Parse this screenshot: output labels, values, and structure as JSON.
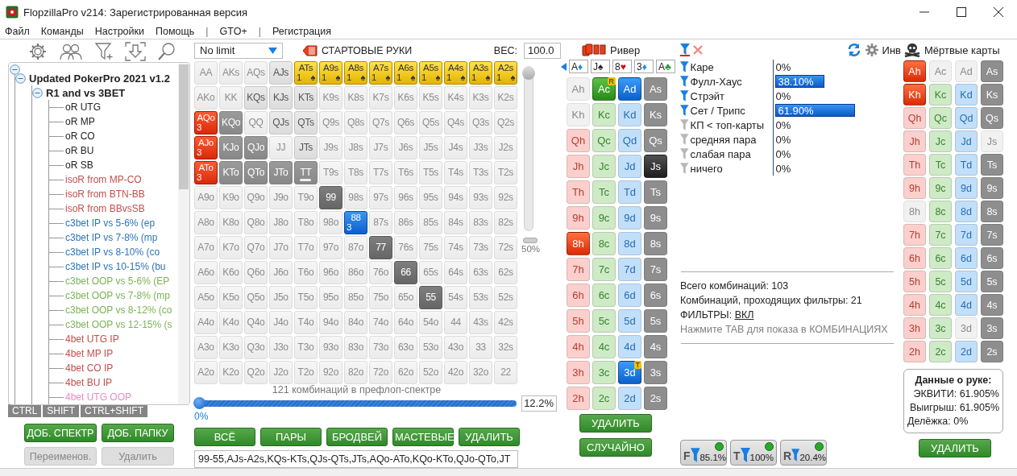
{
  "window": {
    "title": "FlopzillaPro v214: Зарегистрированная версия"
  },
  "menu": [
    {
      "label": "Файл",
      "kind": "item"
    },
    {
      "label": "Команды",
      "kind": "item"
    },
    {
      "label": "Настройки",
      "kind": "item"
    },
    {
      "label": "Помощь",
      "kind": "item"
    },
    {
      "label": "|",
      "kind": "separator"
    },
    {
      "label": "GTO+",
      "kind": "item"
    },
    {
      "label": "|",
      "kind": "separator"
    },
    {
      "label": "Регистрация",
      "kind": "item"
    }
  ],
  "left_panel": {
    "tree": {
      "expanded": true,
      "children": [
        {
          "label": "Updated PokerPro 2021 v1.2",
          "expanded": true,
          "children": [
            {
              "label": "R1 and vs 3BET",
              "expanded": true,
              "children": [
                {
                  "label": "oR UTG",
                  "color": "#222222"
                },
                {
                  "label": "oR MP",
                  "color": "#222222"
                },
                {
                  "label": "oR CO",
                  "color": "#222222"
                },
                {
                  "label": "oR BU",
                  "color": "#222222"
                },
                {
                  "label": "oR SB",
                  "color": "#222222"
                },
                {
                  "label": "isoR from MP-CO",
                  "color": "#c0504d"
                },
                {
                  "label": "isoR from BTN-BB",
                  "color": "#c0504d"
                },
                {
                  "label": "isoR from BBvsSB",
                  "color": "#c0504d"
                },
                {
                  "label": "c3bet IP vs 5-6% (ep",
                  "color": "#2e75b6"
                },
                {
                  "label": "c3bet IP vs 7-8% (mp",
                  "color": "#2e75b6"
                },
                {
                  "label": "c3bet IP vs 8-10% (co",
                  "color": "#2e75b6"
                },
                {
                  "label": "c3bet IP vs 10-15% (bu",
                  "color": "#2e75b6"
                },
                {
                  "label": "c3bet OOP vs 5-6% (EP",
                  "color": "#7ab356"
                },
                {
                  "label": "c3bet OOP vs 7-8% (mp",
                  "color": "#7ab356"
                },
                {
                  "label": "c3bet OOP vs 8-12% (co",
                  "color": "#7ab356"
                },
                {
                  "label": "c3bet OOP vs 12-15% (s",
                  "color": "#7ab356"
                },
                {
                  "label": "4bet UTG IP",
                  "color": "#c0504d"
                },
                {
                  "label": "4bet MP IP",
                  "color": "#c0504d"
                },
                {
                  "label": "4bet CO IP",
                  "color": "#c0504d"
                },
                {
                  "label": "4bet BU IP",
                  "color": "#c0504d"
                },
                {
                  "label": "4bet UTG OOP",
                  "color": "#e88cc0"
                }
              ]
            }
          ]
        }
      ]
    },
    "modifier_tabs": [
      "CTRL",
      "SHIFT",
      "CTRL+SHIFT"
    ],
    "buttons": [
      {
        "label": "ДОБ. СПЕКТР",
        "disabled": false
      },
      {
        "label": "ДОБ. ПАПКУ",
        "disabled": false
      },
      {
        "label": "Переименов.",
        "disabled": true
      },
      {
        "label": "Удалить",
        "disabled": true
      }
    ]
  },
  "range_editor": {
    "game": "No limit",
    "title": "СТАРТОВЫЕ РУКИ",
    "weight_label": "ВЕС:",
    "weight_value": "100.0",
    "grid": [
      [
        {
          "label": "AA",
          "kind": "off"
        },
        {
          "label": "AKs",
          "kind": "off"
        },
        {
          "label": "AQs",
          "kind": "off"
        },
        {
          "label": "AJs",
          "kind": "light"
        },
        {
          "label": "ATs",
          "kind": "yellow",
          "count": "1",
          "suit": "♠"
        },
        {
          "label": "A9s",
          "kind": "yellow",
          "count": "1",
          "suit": "♠"
        },
        {
          "label": "A8s",
          "kind": "yellow",
          "count": "1",
          "suit": "♠"
        },
        {
          "label": "A7s",
          "kind": "yellow",
          "count": "1",
          "suit": "♠"
        },
        {
          "label": "A6s",
          "kind": "yellow",
          "count": "1",
          "suit": "♠"
        },
        {
          "label": "A5s",
          "kind": "yellow",
          "count": "1",
          "suit": "♠"
        },
        {
          "label": "A4s",
          "kind": "yellow",
          "count": "1",
          "suit": "♠"
        },
        {
          "label": "A3s",
          "kind": "yellow",
          "count": "1",
          "suit": "♠"
        },
        {
          "label": "A2s",
          "kind": "yellow",
          "count": "1",
          "suit": "♠"
        }
      ],
      [
        {
          "label": "AKo",
          "kind": "off"
        },
        {
          "label": "KK",
          "kind": "off"
        },
        {
          "label": "KQs",
          "kind": "light"
        },
        {
          "label": "KJs",
          "kind": "light"
        },
        {
          "label": "KTs",
          "kind": "light"
        },
        {
          "label": "K9s",
          "kind": "off"
        },
        {
          "label": "K8s",
          "kind": "off"
        },
        {
          "label": "K7s",
          "kind": "off"
        },
        {
          "label": "K6s",
          "kind": "off"
        },
        {
          "label": "K5s",
          "kind": "off"
        },
        {
          "label": "K4s",
          "kind": "off"
        },
        {
          "label": "K3s",
          "kind": "off"
        },
        {
          "label": "K2s",
          "kind": "off"
        }
      ],
      [
        {
          "label": "AQo",
          "kind": "red",
          "count": "3"
        },
        {
          "label": "KQo",
          "kind": "mid"
        },
        {
          "label": "QQ",
          "kind": "off"
        },
        {
          "label": "QJs",
          "kind": "light"
        },
        {
          "label": "QTs",
          "kind": "light"
        },
        {
          "label": "Q9s",
          "kind": "off"
        },
        {
          "label": "Q8s",
          "kind": "off"
        },
        {
          "label": "Q7s",
          "kind": "off"
        },
        {
          "label": "Q6s",
          "kind": "off"
        },
        {
          "label": "Q5s",
          "kind": "off"
        },
        {
          "label": "Q4s",
          "kind": "off"
        },
        {
          "label": "Q3s",
          "kind": "off"
        },
        {
          "label": "Q2s",
          "kind": "off"
        }
      ],
      [
        {
          "label": "AJo",
          "kind": "red",
          "count": "3"
        },
        {
          "label": "KJo",
          "kind": "mid"
        },
        {
          "label": "QJo",
          "kind": "mid"
        },
        {
          "label": "JJ",
          "kind": "off"
        },
        {
          "label": "JTs",
          "kind": "light"
        },
        {
          "label": "J9s",
          "kind": "off"
        },
        {
          "label": "J8s",
          "kind": "off"
        },
        {
          "label": "J7s",
          "kind": "off"
        },
        {
          "label": "J6s",
          "kind": "off"
        },
        {
          "label": "J5s",
          "kind": "off"
        },
        {
          "label": "J4s",
          "kind": "off"
        },
        {
          "label": "J3s",
          "kind": "off"
        },
        {
          "label": "J2s",
          "kind": "off"
        }
      ],
      [
        {
          "label": "ATo",
          "kind": "red",
          "count": "3"
        },
        {
          "label": "KTo",
          "kind": "mid"
        },
        {
          "label": "QTo",
          "kind": "mid"
        },
        {
          "label": "JTo",
          "kind": "mid"
        },
        {
          "label": "TT",
          "kind": "mid",
          "partial": true
        },
        {
          "label": "T9s",
          "kind": "off"
        },
        {
          "label": "T8s",
          "kind": "off"
        },
        {
          "label": "T7s",
          "kind": "off"
        },
        {
          "label": "T6s",
          "kind": "off"
        },
        {
          "label": "T5s",
          "kind": "off"
        },
        {
          "label": "T4s",
          "kind": "off"
        },
        {
          "label": "T3s",
          "kind": "off"
        },
        {
          "label": "T2s",
          "kind": "off"
        }
      ],
      [
        {
          "label": "A9o",
          "kind": "off"
        },
        {
          "label": "K9o",
          "kind": "off"
        },
        {
          "label": "Q9o",
          "kind": "off"
        },
        {
          "label": "J9o",
          "kind": "off"
        },
        {
          "label": "T9o",
          "kind": "off"
        },
        {
          "label": "99",
          "kind": "dark"
        },
        {
          "label": "98s",
          "kind": "off"
        },
        {
          "label": "97s",
          "kind": "off"
        },
        {
          "label": "96s",
          "kind": "off"
        },
        {
          "label": "95s",
          "kind": "off"
        },
        {
          "label": "94s",
          "kind": "off"
        },
        {
          "label": "93s",
          "kind": "off"
        },
        {
          "label": "92s",
          "kind": "off"
        }
      ],
      [
        {
          "label": "A8o",
          "kind": "off"
        },
        {
          "label": "K8o",
          "kind": "off"
        },
        {
          "label": "Q8o",
          "kind": "off"
        },
        {
          "label": "J8o",
          "kind": "off"
        },
        {
          "label": "T8o",
          "kind": "off"
        },
        {
          "label": "98o",
          "kind": "off"
        },
        {
          "label": "88",
          "kind": "blue",
          "count": "3"
        },
        {
          "label": "87s",
          "kind": "off"
        },
        {
          "label": "86s",
          "kind": "off"
        },
        {
          "label": "85s",
          "kind": "off"
        },
        {
          "label": "84s",
          "kind": "off"
        },
        {
          "label": "83s",
          "kind": "off"
        },
        {
          "label": "82s",
          "kind": "off"
        }
      ],
      [
        {
          "label": "A7o",
          "kind": "off"
        },
        {
          "label": "K7o",
          "kind": "off"
        },
        {
          "label": "Q7o",
          "kind": "off"
        },
        {
          "label": "J7o",
          "kind": "off"
        },
        {
          "label": "T7o",
          "kind": "off"
        },
        {
          "label": "97o",
          "kind": "off"
        },
        {
          "label": "87o",
          "kind": "off"
        },
        {
          "label": "77",
          "kind": "dark"
        },
        {
          "label": "76s",
          "kind": "off"
        },
        {
          "label": "75s",
          "kind": "off"
        },
        {
          "label": "74s",
          "kind": "off"
        },
        {
          "label": "73s",
          "kind": "off"
        },
        {
          "label": "72s",
          "kind": "off"
        }
      ],
      [
        {
          "label": "A6o",
          "kind": "off"
        },
        {
          "label": "K6o",
          "kind": "off"
        },
        {
          "label": "Q6o",
          "kind": "off"
        },
        {
          "label": "J6o",
          "kind": "off"
        },
        {
          "label": "T6o",
          "kind": "off"
        },
        {
          "label": "96o",
          "kind": "off"
        },
        {
          "label": "86o",
          "kind": "off"
        },
        {
          "label": "76o",
          "kind": "off"
        },
        {
          "label": "66",
          "kind": "dark"
        },
        {
          "label": "65s",
          "kind": "off"
        },
        {
          "label": "64s",
          "kind": "off"
        },
        {
          "label": "63s",
          "kind": "off"
        },
        {
          "label": "62s",
          "kind": "off"
        }
      ],
      [
        {
          "label": "A5o",
          "kind": "off"
        },
        {
          "label": "K5o",
          "kind": "off"
        },
        {
          "label": "Q5o",
          "kind": "off"
        },
        {
          "label": "J5o",
          "kind": "off"
        },
        {
          "label": "T5o",
          "kind": "off"
        },
        {
          "label": "95o",
          "kind": "off"
        },
        {
          "label": "85o",
          "kind": "off"
        },
        {
          "label": "75o",
          "kind": "off"
        },
        {
          "label": "65o",
          "kind": "off"
        },
        {
          "label": "55",
          "kind": "dark"
        },
        {
          "label": "54s",
          "kind": "off"
        },
        {
          "label": "53s",
          "kind": "off"
        },
        {
          "label": "52s",
          "kind": "off"
        }
      ],
      [
        {
          "label": "A4o",
          "kind": "off"
        },
        {
          "label": "K4o",
          "kind": "off"
        },
        {
          "label": "Q4o",
          "kind": "off"
        },
        {
          "label": "J4o",
          "kind": "off"
        },
        {
          "label": "T4o",
          "kind": "off"
        },
        {
          "label": "94o",
          "kind": "off"
        },
        {
          "label": "84o",
          "kind": "off"
        },
        {
          "label": "74o",
          "kind": "off"
        },
        {
          "label": "64o",
          "kind": "off"
        },
        {
          "label": "54o",
          "kind": "off"
        },
        {
          "label": "44",
          "kind": "off"
        },
        {
          "label": "43s",
          "kind": "off"
        },
        {
          "label": "42s",
          "kind": "off"
        }
      ],
      [
        {
          "label": "A3o",
          "kind": "off"
        },
        {
          "label": "K3o",
          "kind": "off"
        },
        {
          "label": "Q3o",
          "kind": "off"
        },
        {
          "label": "J3o",
          "kind": "off"
        },
        {
          "label": "T3o",
          "kind": "off"
        },
        {
          "label": "93o",
          "kind": "off"
        },
        {
          "label": "83o",
          "kind": "off"
        },
        {
          "label": "73o",
          "kind": "off"
        },
        {
          "label": "63o",
          "kind": "off"
        },
        {
          "label": "53o",
          "kind": "off"
        },
        {
          "label": "43o",
          "kind": "off"
        },
        {
          "label": "33",
          "kind": "off"
        },
        {
          "label": "32s",
          "kind": "off"
        }
      ],
      [
        {
          "label": "A2o",
          "kind": "off"
        },
        {
          "label": "K2o",
          "kind": "off"
        },
        {
          "label": "Q2o",
          "kind": "off"
        },
        {
          "label": "J2o",
          "kind": "off"
        },
        {
          "label": "T2o",
          "kind": "off"
        },
        {
          "label": "92o",
          "kind": "off"
        },
        {
          "label": "82o",
          "kind": "off"
        },
        {
          "label": "72o",
          "kind": "off"
        },
        {
          "label": "62o",
          "kind": "off"
        },
        {
          "label": "52o",
          "kind": "off"
        },
        {
          "label": "42o",
          "kind": "off"
        },
        {
          "label": "32o",
          "kind": "off"
        },
        {
          "label": "22",
          "kind": "off"
        }
      ]
    ],
    "weight_slider": {
      "level": 1,
      "reading": "50%"
    },
    "combos_caption": "121 комбинаций в префлоп-спектре",
    "range_slider": {
      "level": 0,
      "reading": "0%",
      "value": "12.2%"
    },
    "buttons": [
      "ВСЁ",
      "ПАРЫ",
      "БРОДВЕЙ",
      "МАСТЕВЫЕ",
      "УДАЛИТЬ"
    ],
    "range_text": "99-55,AJs-A2s,KQs-KTs,QJs-QTs,JTs,AQo-ATo,KQo-KTo,QJo-QTo,JT"
  },
  "board": {
    "street": "Ривер",
    "cards": [
      {
        "rank": "A",
        "suit": "♦",
        "color": "#1a8cf0"
      },
      {
        "rank": "J",
        "suit": "♠",
        "color": "#222222"
      },
      {
        "rank": "8",
        "suit": "♥",
        "color": "#d01010"
      },
      {
        "rank": "3",
        "suit": "♦",
        "color": "#1a8cf0"
      },
      {
        "rank": "A",
        "suit": "♣",
        "color": "#2a9a2a"
      }
    ],
    "deck": [
      [
        {
          "label": "Ah",
          "kind": "blocked"
        },
        {
          "label": "Ac",
          "kind": "selected",
          "badge": "R"
        },
        {
          "label": "Ad",
          "kind": "selected"
        },
        {
          "label": "As",
          "kind": "normal"
        }
      ],
      [
        {
          "label": "Kh",
          "kind": "blocked"
        },
        {
          "label": "Kc",
          "kind": "normal"
        },
        {
          "label": "Kd",
          "kind": "normal"
        },
        {
          "label": "Ks",
          "kind": "normal"
        }
      ],
      [
        {
          "label": "Qh",
          "kind": "normal"
        },
        {
          "label": "Qc",
          "kind": "normal"
        },
        {
          "label": "Qd",
          "kind": "normal"
        },
        {
          "label": "Qs",
          "kind": "normal"
        }
      ],
      [
        {
          "label": "Jh",
          "kind": "normal"
        },
        {
          "label": "Jc",
          "kind": "normal"
        },
        {
          "label": "Jd",
          "kind": "normal"
        },
        {
          "label": "Js",
          "kind": "selected"
        }
      ],
      [
        {
          "label": "Th",
          "kind": "normal"
        },
        {
          "label": "Tc",
          "kind": "normal"
        },
        {
          "label": "Td",
          "kind": "normal"
        },
        {
          "label": "Ts",
          "kind": "normal"
        }
      ],
      [
        {
          "label": "9h",
          "kind": "normal"
        },
        {
          "label": "9c",
          "kind": "normal"
        },
        {
          "label": "9d",
          "kind": "normal"
        },
        {
          "label": "9s",
          "kind": "normal"
        }
      ],
      [
        {
          "label": "8h",
          "kind": "selected"
        },
        {
          "label": "8c",
          "kind": "normal"
        },
        {
          "label": "8d",
          "kind": "normal"
        },
        {
          "label": "8s",
          "kind": "normal"
        }
      ],
      [
        {
          "label": "7h",
          "kind": "normal"
        },
        {
          "label": "7c",
          "kind": "normal"
        },
        {
          "label": "7d",
          "kind": "normal"
        },
        {
          "label": "7s",
          "kind": "normal"
        }
      ],
      [
        {
          "label": "6h",
          "kind": "normal"
        },
        {
          "label": "6c",
          "kind": "normal"
        },
        {
          "label": "6d",
          "kind": "normal"
        },
        {
          "label": "6s",
          "kind": "normal"
        }
      ],
      [
        {
          "label": "5h",
          "kind": "normal"
        },
        {
          "label": "5c",
          "kind": "normal"
        },
        {
          "label": "5d",
          "kind": "normal"
        },
        {
          "label": "5s",
          "kind": "normal"
        }
      ],
      [
        {
          "label": "4h",
          "kind": "normal"
        },
        {
          "label": "4c",
          "kind": "normal"
        },
        {
          "label": "4d",
          "kind": "normal"
        },
        {
          "label": "4s",
          "kind": "normal"
        }
      ],
      [
        {
          "label": "3h",
          "kind": "normal"
        },
        {
          "label": "3c",
          "kind": "normal"
        },
        {
          "label": "3d",
          "kind": "selected",
          "badge": "T"
        },
        {
          "label": "3s",
          "kind": "normal"
        }
      ],
      [
        {
          "label": "2h",
          "kind": "normal"
        },
        {
          "label": "2c",
          "kind": "normal"
        },
        {
          "label": "2d",
          "kind": "normal"
        },
        {
          "label": "2s",
          "kind": "normal"
        }
      ]
    ],
    "buttons": [
      "УДАЛИТЬ",
      "СЛУЧАЙНО"
    ]
  },
  "filters": {
    "invert_label": "Инв",
    "items": [
      {
        "label": "Каре",
        "active": true,
        "value": "0%"
      },
      {
        "label": "Фулл-Хаус",
        "active": true,
        "value": "38.10%",
        "level": 0.381
      },
      {
        "label": "Стрэйт",
        "active": true,
        "value": "0%"
      },
      {
        "label": "Сет / Трипс",
        "active": true,
        "value": "61.90%",
        "level": 0.619
      },
      {
        "label": "КП < топ-карты",
        "active": false,
        "value": "0%"
      },
      {
        "label": "средняя пара",
        "active": false,
        "value": "0%"
      },
      {
        "label": "слабая пара",
        "active": false,
        "value": "0%"
      },
      {
        "label": "ничего",
        "active": false,
        "value": "0%"
      }
    ],
    "stats": [
      "Всего комбинаций: 103",
      "Комбинаций, проходящих фильтры: 21"
    ],
    "filters_state": {
      "label": "ФИЛЬТРЫ:",
      "value": "ВКЛ"
    },
    "hint": "Нажмите TAB для показа в КОМБИНАЦИЯХ",
    "street_filters": [
      {
        "letter": "F",
        "value": "85.1%",
        "on": true
      },
      {
        "letter": "T",
        "value": "100%",
        "on": true
      },
      {
        "letter": "R",
        "value": "20.4%",
        "on": true
      }
    ]
  },
  "dead_cards": {
    "title": "Мёртвые карты",
    "deck": [
      [
        {
          "label": "Ah",
          "kind": "selected"
        },
        {
          "label": "Ac",
          "kind": "blocked"
        },
        {
          "label": "Ad",
          "kind": "blocked"
        },
        {
          "label": "As",
          "kind": "normal"
        }
      ],
      [
        {
          "label": "Kh",
          "kind": "selected"
        },
        {
          "label": "Kc",
          "kind": "normal"
        },
        {
          "label": "Kd",
          "kind": "normal"
        },
        {
          "label": "Ks",
          "kind": "normal"
        }
      ],
      [
        {
          "label": "Qh",
          "kind": "normal"
        },
        {
          "label": "Qc",
          "kind": "normal"
        },
        {
          "label": "Qd",
          "kind": "normal"
        },
        {
          "label": "Qs",
          "kind": "normal"
        }
      ],
      [
        {
          "label": "Jh",
          "kind": "normal"
        },
        {
          "label": "Jc",
          "kind": "normal"
        },
        {
          "label": "Jd",
          "kind": "normal"
        },
        {
          "label": "Js",
          "kind": "blocked"
        }
      ],
      [
        {
          "label": "Th",
          "kind": "normal"
        },
        {
          "label": "Tc",
          "kind": "normal"
        },
        {
          "label": "Td",
          "kind": "normal"
        },
        {
          "label": "Ts",
          "kind": "normal"
        }
      ],
      [
        {
          "label": "9h",
          "kind": "normal"
        },
        {
          "label": "9c",
          "kind": "normal"
        },
        {
          "label": "9d",
          "kind": "normal"
        },
        {
          "label": "9s",
          "kind": "normal"
        }
      ],
      [
        {
          "label": "8h",
          "kind": "blocked"
        },
        {
          "label": "8c",
          "kind": "normal"
        },
        {
          "label": "8d",
          "kind": "normal"
        },
        {
          "label": "8s",
          "kind": "normal"
        }
      ],
      [
        {
          "label": "7h",
          "kind": "normal"
        },
        {
          "label": "7c",
          "kind": "normal"
        },
        {
          "label": "7d",
          "kind": "normal"
        },
        {
          "label": "7s",
          "kind": "normal"
        }
      ],
      [
        {
          "label": "6h",
          "kind": "normal"
        },
        {
          "label": "6c",
          "kind": "normal"
        },
        {
          "label": "6d",
          "kind": "normal"
        },
        {
          "label": "6s",
          "kind": "normal"
        }
      ],
      [
        {
          "label": "5h",
          "kind": "normal"
        },
        {
          "label": "5c",
          "kind": "normal"
        },
        {
          "label": "5d",
          "kind": "normal"
        },
        {
          "label": "5s",
          "kind": "normal"
        }
      ],
      [
        {
          "label": "4h",
          "kind": "normal"
        },
        {
          "label": "4c",
          "kind": "normal"
        },
        {
          "label": "4d",
          "kind": "normal"
        },
        {
          "label": "4s",
          "kind": "normal"
        }
      ],
      [
        {
          "label": "3h",
          "kind": "normal"
        },
        {
          "label": "3c",
          "kind": "normal"
        },
        {
          "label": "3d",
          "kind": "blocked"
        },
        {
          "label": "3s",
          "kind": "normal"
        }
      ],
      [
        {
          "label": "2h",
          "kind": "normal"
        },
        {
          "label": "2c",
          "kind": "normal"
        },
        {
          "label": "2d",
          "kind": "normal"
        },
        {
          "label": "2s",
          "kind": "normal"
        }
      ]
    ],
    "hand_info": {
      "title": "Данные о руке:",
      "lines": [
        "ЭКВИТИ: 61.905%",
        "Выигрыш: 61.905%",
        "Делёжка: 0%"
      ]
    },
    "button": "УДАЛИТЬ"
  }
}
